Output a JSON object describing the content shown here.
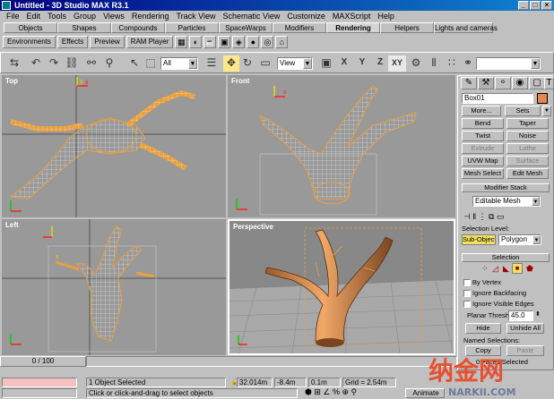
{
  "window": {
    "title": "Untitled - 3D Studio MAX R3.1"
  },
  "menu": [
    "File",
    "Edit",
    "Tools",
    "Group",
    "Views",
    "Rendering",
    "Track View",
    "Schematic View",
    "Customize",
    "MAXScript",
    "Help"
  ],
  "tab_panel": {
    "tabs": [
      "Objects",
      "Shapes",
      "Compounds",
      "Particles",
      "SpaceWarps",
      "Modifiers",
      "Rendering",
      "Helpers",
      "Lights and cameras"
    ],
    "active_tab": "Rendering",
    "buttons": [
      "Environments",
      "Effects",
      "Preview",
      "RAM Player"
    ]
  },
  "toolbar": {
    "selection_filter": "All",
    "reference_coord": "View",
    "axis_labels": [
      "X",
      "Y",
      "Z",
      "XY"
    ]
  },
  "viewports": {
    "top": "Top",
    "front": "Front",
    "left": "Left",
    "perspective": "Perspective"
  },
  "command_panel": {
    "object_name": "Box01",
    "object_color": "#e08850",
    "more_button": "More...",
    "sets_button": "Sets",
    "modifier_buttons": [
      "Bend",
      "Taper",
      "Twist",
      "Noise",
      "Extrude",
      "Lathe",
      "UVW Map",
      "Surface",
      "Mesh Select",
      "Edit Mesh"
    ],
    "disabled_modifiers": [
      "Extrude",
      "Lathe",
      "Surface"
    ],
    "modifier_stack_title": "Modifier Stack",
    "modifier_stack_value": "Editable Mesh",
    "selection_level_label": "Selection Level:",
    "sub_object_button": "Sub-Object",
    "sub_object_level": "Polygon",
    "selection_rollout_title": "Selection",
    "by_vertex": "By Vertex",
    "ignore_backfacing": "Ignore Backfacing",
    "ignore_visible_edges": "Ignore Visible Edges",
    "planar_thresh_label": "Planar Thresh:",
    "planar_thresh_value": "45.0",
    "hide_button": "Hide",
    "unhide_all_button": "Unhide All",
    "named_selections_label": "Named Selections:",
    "copy_button": "Copy",
    "paste_button": "Paste",
    "faces_selected": "0 Faces Selected"
  },
  "status": {
    "time_slider": "0 / 100",
    "selection_info": "1 Object Selected",
    "prompt": "Click or click-and-drag to select objects",
    "x_coord": "32.014m",
    "y_coord": "-8.4m",
    "z_coord": "0.1m",
    "grid": "Grid = 2.54m",
    "animate": "Animate"
  },
  "watermark": {
    "text": "纳金网",
    "url": "NARKII.COM"
  },
  "colors": {
    "viewport_bg": "#999999",
    "wire_color": "#ffffff",
    "selection_color": "#e8a040",
    "title_gradient_start": "#000080"
  }
}
